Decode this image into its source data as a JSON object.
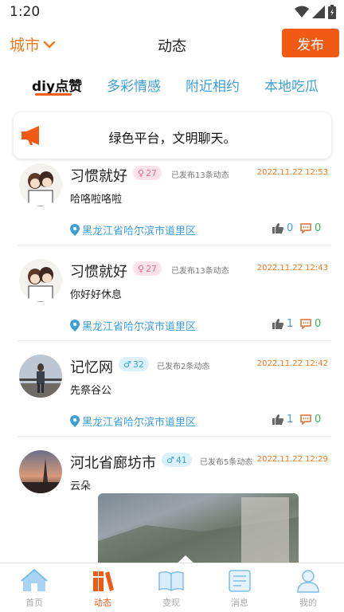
{
  "status_bar": {
    "time": "1:20"
  },
  "header": {
    "city": "城市",
    "title": "动态",
    "publish": "发布"
  },
  "tabs": [
    {
      "label": "diy点赞",
      "active": true
    },
    {
      "label": "多彩情感",
      "active": false
    },
    {
      "label": "附近相约",
      "active": false
    },
    {
      "label": "本地吃瓜",
      "active": false
    }
  ],
  "notice": {
    "text": "绿色平台，文明聊天。"
  },
  "posts": [
    {
      "name": "习惯就好",
      "gender": "female",
      "age": "27",
      "post_count": "已发布13条动态",
      "time": "2022.11.22 12:53",
      "content": "哈咯啦咯啦",
      "location": "黑龙江省哈尔滨市道里区",
      "likes": "0",
      "comments": "0"
    },
    {
      "name": "习惯就好",
      "gender": "female",
      "age": "27",
      "post_count": "已发布13条动态",
      "time": "2022.11.22 12:43",
      "content": "你好好休息",
      "location": "黑龙江省哈尔滨市道里区",
      "likes": "1",
      "comments": "0"
    },
    {
      "name": "记忆网",
      "gender": "male",
      "age": "32",
      "post_count": "已发布2条动态",
      "time": "2022.11.22 12:42",
      "content": "先祭谷公",
      "location": "黑龙江省哈尔滨市道里区",
      "likes": "1",
      "comments": "0"
    },
    {
      "name": "河北省廊坊市",
      "gender": "male",
      "age": "41",
      "post_count": "已发布5条动态",
      "time": "2022.11.22 12:29",
      "content": "云朵"
    }
  ],
  "bottom_nav": [
    {
      "label": "首页",
      "icon": "home-icon",
      "active": false
    },
    {
      "label": "动态",
      "icon": "books-icon",
      "active": true
    },
    {
      "label": "变现",
      "icon": "book-open-icon",
      "active": false
    },
    {
      "label": "消息",
      "icon": "message-doc-icon",
      "active": false
    },
    {
      "label": "我的",
      "icon": "user-icon",
      "active": false
    }
  ],
  "colors": {
    "accent": "#f05a14",
    "orange_text": "#f07a1e",
    "link_blue": "#3da0d8",
    "green": "#3bb25a"
  }
}
